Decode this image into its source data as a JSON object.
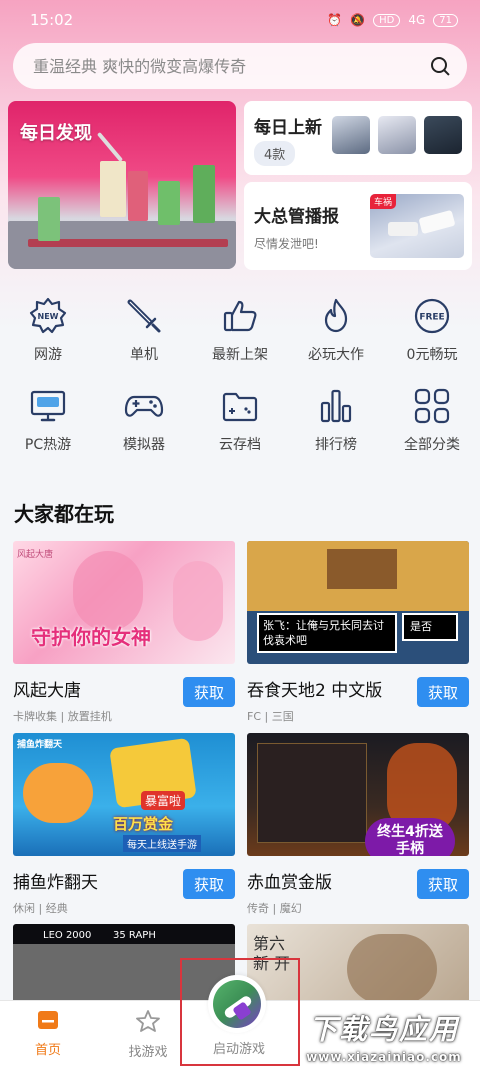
{
  "status_bar": {
    "time": "15:02",
    "hd": "HD",
    "network": "4G",
    "battery": "71"
  },
  "search": {
    "placeholder": "重温经典 爽快的微变高爆传奇"
  },
  "banners": {
    "daily": {
      "title": "每日发现"
    },
    "new": {
      "title": "每日上新",
      "badge": "4款"
    },
    "report": {
      "title": "大总管播报",
      "subtitle": "尽情发泄吧!",
      "tag": "车祸"
    }
  },
  "categories": [
    {
      "label": "网游",
      "icon": "new-badge-icon",
      "text": "NEW"
    },
    {
      "label": "单机",
      "icon": "sword-icon"
    },
    {
      "label": "最新上架",
      "icon": "thumbs-up-icon"
    },
    {
      "label": "必玩大作",
      "icon": "flame-icon"
    },
    {
      "label": "0元畅玩",
      "icon": "free-badge-icon",
      "text": "FREE"
    },
    {
      "label": "PC热游",
      "icon": "monitor-icon"
    },
    {
      "label": "模拟器",
      "icon": "gamepad-icon"
    },
    {
      "label": "云存档",
      "icon": "cloud-folder-icon"
    },
    {
      "label": "排行榜",
      "icon": "bar-chart-icon"
    },
    {
      "label": "全部分类",
      "icon": "grid-icon"
    }
  ],
  "section_title": "大家都在玩",
  "games": [
    {
      "name": "风起大唐",
      "meta": "卡牌收集 | 放置挂机",
      "button": "获取",
      "cover_text": "守护你的女神",
      "cover_logo": "风起大唐"
    },
    {
      "name": "吞食天地2 中文版",
      "meta": "FC | 三国",
      "button": "获取",
      "cover_text": "张飞：让俺与兄长同去讨伐袁术吧",
      "cover_text2": "是否"
    },
    {
      "name": "捕鱼炸翻天",
      "meta": "休闲 | 经典",
      "button": "获取",
      "cover_text": "百万赏金",
      "cover_text2": "每天上线送手游",
      "cover_badge": "暴富啦",
      "cover_logo": "捕鱼炸翻天"
    },
    {
      "name": "赤血赏金版",
      "meta": "传奇 | 魔幻",
      "button": "获取",
      "cover_badge": "终生4折送手柄"
    }
  ],
  "partial_games": [
    {
      "cover_text": "35 RAPH",
      "cover_text2": "LEO 2000"
    },
    {
      "cover_text": "第六 新 开"
    }
  ],
  "bottom_nav": [
    {
      "label": "首页",
      "icon": "home-icon",
      "active": true
    },
    {
      "label": "找游戏",
      "icon": "star-icon",
      "active": false
    },
    {
      "label": "启动游戏",
      "icon": "launch-game-icon",
      "active": false
    }
  ],
  "watermark": {
    "title": "下载鸟应用",
    "url": "www.xiazainiao.com"
  },
  "colors": {
    "accent": "#2f8ef0",
    "active_nav": "#f07a18",
    "header_pink": "#f6a3c1"
  }
}
